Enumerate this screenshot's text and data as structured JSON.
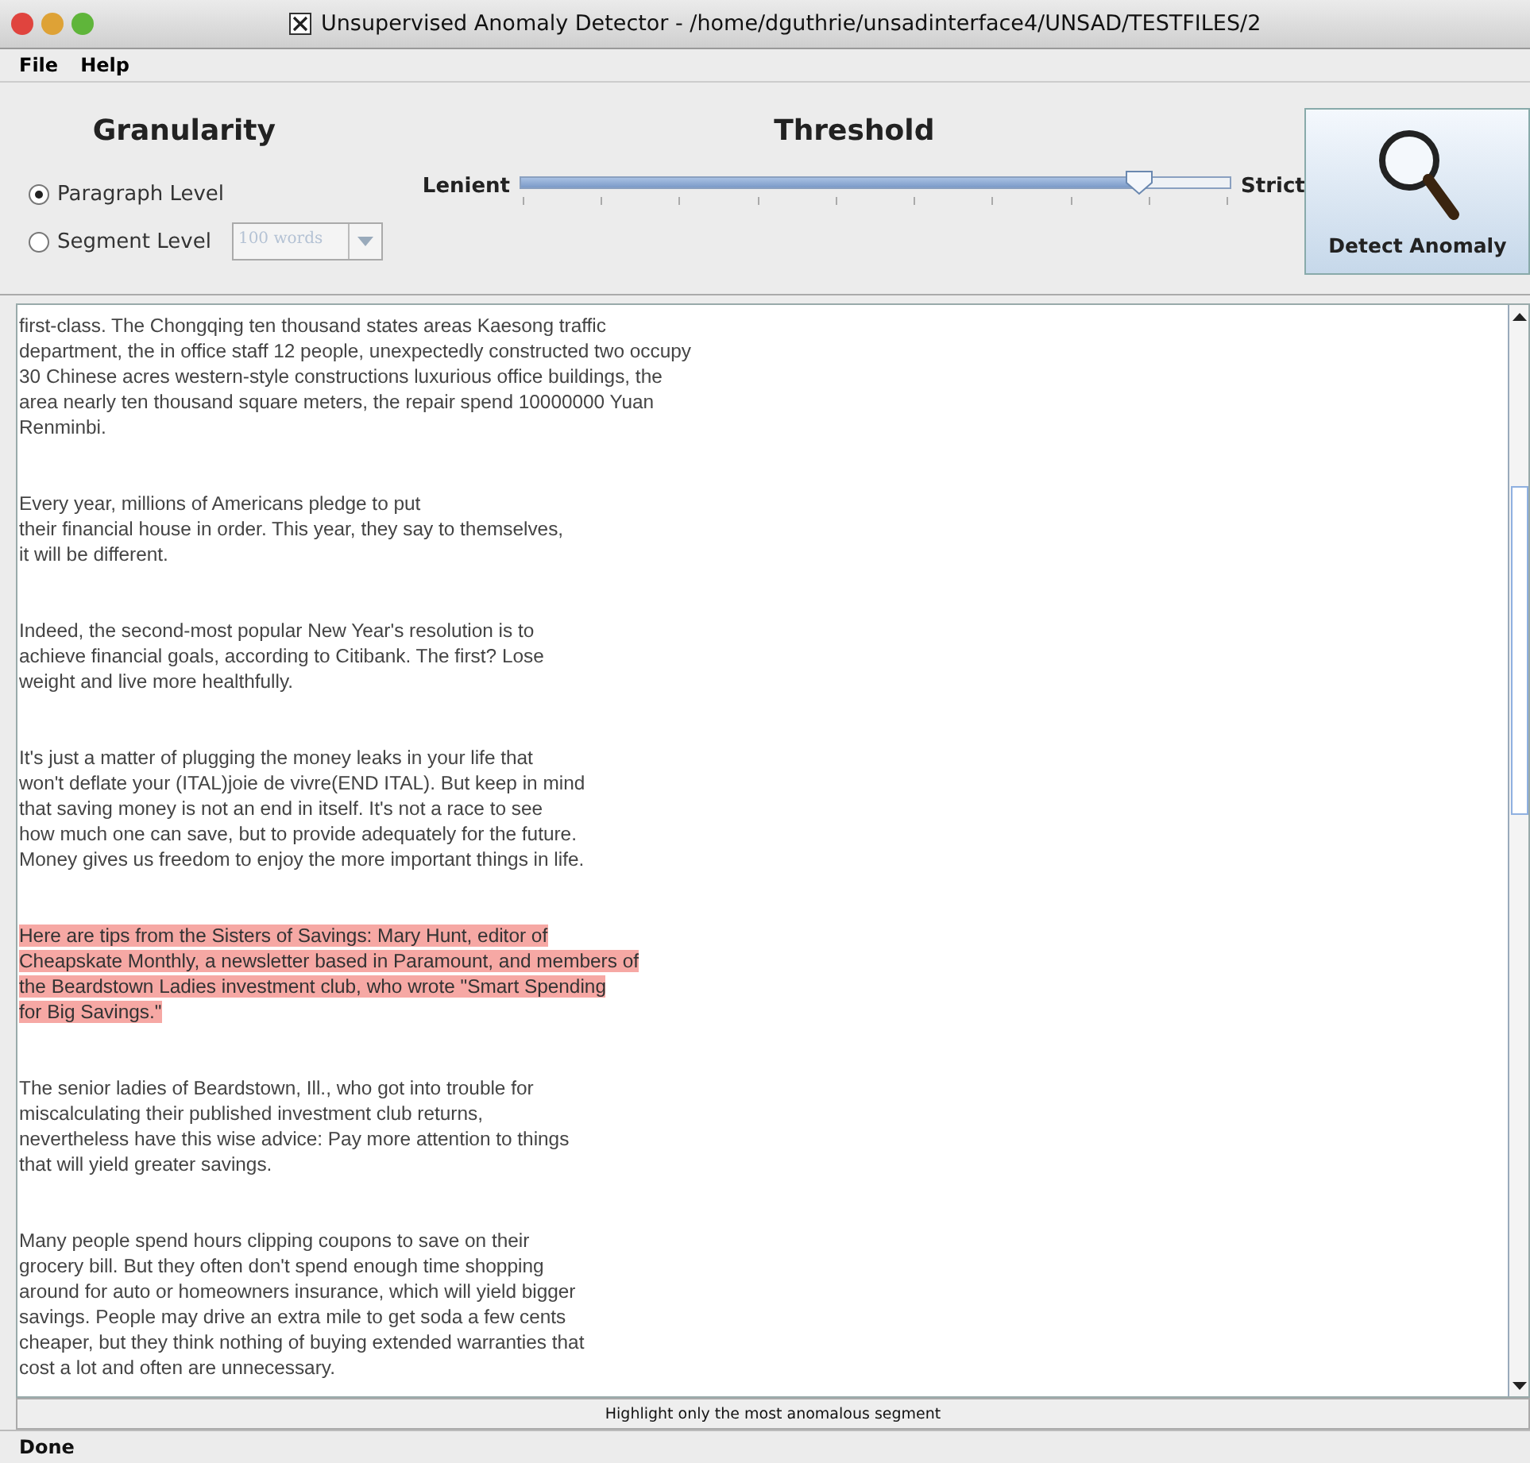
{
  "window": {
    "title": "Unsupervised Anomaly Detector - /home/dguthrie/unsadinterface4/UNSAD/TESTFILES/2"
  },
  "menu": [
    "File",
    "Help"
  ],
  "granularity": {
    "title": "Granularity",
    "options": [
      {
        "label": "Paragraph Level",
        "selected": true
      },
      {
        "label": "Segment Level",
        "selected": false
      }
    ],
    "segment_size": {
      "value": "100 words",
      "disabled": true
    }
  },
  "threshold": {
    "title": "Threshold",
    "min_label": "Lenient",
    "max_label": "Strict",
    "level": 0.87
  },
  "detect_button": "Detect Anomaly",
  "paragraphs": [
    {
      "highlighted": false,
      "lines": [
        "first-class. The Chongqing ten thousand  states areas Kaesong traffic",
        "department, the in office staff 12  people, unexpectedly constructed two occupy",
        "30 Chinese acres  western-style constructions luxurious office buildings, the",
        "area  nearly ten thousand square meters, the repair spend 10000000 Yuan",
        "Renminbi."
      ]
    },
    {
      "highlighted": false,
      "lines": [
        "Every year, millions of Americans pledge to put",
        "their financial house in order. This year, they say to themselves,",
        "it will be different."
      ]
    },
    {
      "highlighted": false,
      "lines": [
        "Indeed, the second-most popular New Year's resolution is to",
        "achieve financial goals, according to Citibank. The first? Lose",
        "weight and live more healthfully."
      ]
    },
    {
      "highlighted": false,
      "lines": [
        "It's just a matter of plugging the money leaks in your life that",
        "won't deflate your (ITAL)joie de vivre(END ITAL). But keep in mind",
        "that saving money is not an end in itself. It's not a race to see",
        "how much one can save, but to provide adequately for the future.",
        "Money gives us freedom to enjoy the more important things in life."
      ]
    },
    {
      "highlighted": true,
      "lines": [
        "Here are tips from the Sisters of Savings: Mary Hunt, editor of",
        "Cheapskate Monthly, a newsletter based in Paramount, and members of",
        "the Beardstown Ladies investment club, who wrote \"Smart Spending",
        "for Big Savings.\""
      ]
    },
    {
      "highlighted": false,
      "lines": [
        "The senior ladies of Beardstown, Ill., who got into trouble for",
        "miscalculating their published investment club returns,",
        "nevertheless have this wise advice: Pay more attention to things",
        "that will yield greater savings."
      ]
    },
    {
      "highlighted": false,
      "lines": [
        "Many people spend hours clipping coupons to save on their",
        "grocery bill. But they often don't spend enough time shopping",
        "around for auto or homeowners insurance, which will yield bigger",
        "savings. People may drive an extra mile to get soda a few cents",
        "cheaper, but they think nothing of buying extended warranties that",
        "cost a lot and often are unnecessary."
      ]
    }
  ],
  "hint_bar": "Highlight only the most anomalous segment",
  "status_bar": "Done"
}
